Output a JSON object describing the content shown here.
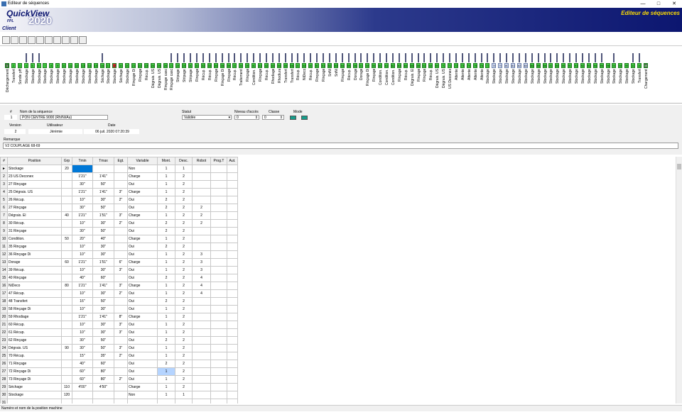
{
  "window": {
    "title": "Editeur de séquences",
    "min": "—",
    "max": "□",
    "close": "✕"
  },
  "banner": {
    "product": "QuickView",
    "fpl": "FPL",
    "year": "2020",
    "client": "Client",
    "heading": "Editeur de séquences"
  },
  "toolbar": {
    "tools": [
      "open-icon",
      "new-icon",
      "save-icon",
      "print-icon",
      "import-icon",
      "export-icon",
      "folder-icon",
      "tree-icon",
      "info-icon",
      "help-icon"
    ]
  },
  "sequence": {
    "positions": [
      "Déchargement",
      "Transfert",
      "Sonde pH",
      "Stockage",
      "Stockage",
      "Stockage",
      "Stockage",
      "Stockage",
      "Stockage",
      "Stockage",
      "Stockage",
      "Stockage",
      "Stockage",
      "Stockage",
      "Stockage",
      "Séchage",
      "Stockage",
      "Stockage",
      "Séchage",
      "Stockage",
      "Rinçage Di",
      "Rinçage",
      "Récup.",
      "Dégrais. US",
      "Dégrais. US",
      "Rinçage casc",
      "Rinçage casc",
      "Stripage",
      "Stripage",
      "Stripage",
      "Rinçage",
      "Récup.",
      "Récup.",
      "Rinçage",
      "Rinçage Di",
      "Rinçage",
      "Récup.",
      "Traitement",
      "Rinçage",
      "Condition.",
      "Rinçage",
      "Récup.",
      "Rhodiage",
      "Rhodiura",
      "Transfert",
      "Transfert",
      "Récup.",
      "NiDeco",
      "Récup.",
      "Rinçage",
      "Rinçage",
      "SnNi",
      "SnNi",
      "Rinçage",
      "Récup.",
      "Dorage",
      "Dorage",
      "Rinçage Di",
      "Rinçage",
      "Condition.",
      "Condition.",
      "Condition.",
      "Rinçage",
      "Récup.",
      "Dégrais. El",
      "Rinçage",
      "Rinçage",
      "Récup.",
      "Dégrais. US",
      "Dégrais. US",
      "US Deconex",
      "Attente",
      "Attente",
      "Attente",
      "Attente",
      "Attente",
      "Stockage",
      "Stockage",
      "Stockage",
      "Stockage",
      "Stockage",
      "Stockage",
      "Stockage",
      "Stockage",
      "Stockage",
      "Stockage",
      "Stockage",
      "Stockage",
      "Stockage",
      "Stockage",
      "Stockage",
      "Stockage",
      "Stockage",
      "Stockage",
      "Stockage",
      "Stockage",
      "Stockage",
      "Stockage",
      "Stockage",
      "Stockage",
      "Transfert",
      "Chargement"
    ]
  },
  "form": {
    "num_label": "#",
    "num_value": "1",
    "name_label": "Nom de la séquence",
    "name_value": "PON CENTRE 9000 (Rh/Ni/Au)",
    "statut_label": "Statut",
    "statut_value": "Validée",
    "niveau_label": "Niveau d'accès",
    "niveau_value": "0",
    "classe_label": "Classe",
    "classe_value": "0",
    "mode_label": "Mode",
    "version_label": "Version",
    "version_value": "2",
    "user_label": "Utilisateur",
    "user_value": "Jérémie",
    "date_label": "Date",
    "date_value": "06 juil. 2020 07:20:39",
    "remarque_label": "Remarque",
    "remarque_value": "V2 COUPLAGE 68-69"
  },
  "grid": {
    "headers": [
      "#",
      "Position",
      "Grp",
      "Tmin",
      "Tmax",
      "Egt.",
      "Variable",
      "Mont.",
      "Desc.",
      "Robot",
      "Prog.T",
      "Aut."
    ],
    "rows": [
      [
        "►",
        "Stockage",
        "20",
        "",
        "",
        "",
        "Non",
        "1",
        "1",
        "",
        "",
        ""
      ],
      [
        "2",
        "23 US Deconex",
        "",
        "1'21''",
        "1'41''",
        "",
        "Charge",
        "1",
        "2",
        "",
        "",
        ""
      ],
      [
        "3",
        "27 Rinçage",
        "",
        "30''",
        "50''",
        "",
        "Oui",
        "1",
        "2",
        "",
        "",
        ""
      ],
      [
        "4",
        "25 Dégrais. US",
        "",
        "1'21''",
        "1'41''",
        "3''",
        "Charge",
        "1",
        "2",
        "",
        "",
        ""
      ],
      [
        "5",
        "26 Récup.",
        "",
        "10''",
        "30''",
        "2''",
        "Oui",
        "2",
        "2",
        "",
        "",
        ""
      ],
      [
        "6",
        "27 Rinçage",
        "",
        "30''",
        "50''",
        "",
        "Oui",
        "2",
        "2",
        "2",
        "",
        ""
      ],
      [
        "7",
        "Dégrais. El",
        "40",
        "1'21''",
        "1'51''",
        "3''",
        "Charge",
        "1",
        "2",
        "2",
        "",
        ""
      ],
      [
        "8",
        "30 Récup.",
        "",
        "10''",
        "30''",
        "2''",
        "Oui",
        "2",
        "2",
        "2",
        "",
        ""
      ],
      [
        "9",
        "31 Rinçage",
        "",
        "30''",
        "50''",
        "",
        "Oui",
        "2",
        "2",
        "",
        "",
        ""
      ],
      [
        "10",
        "Condition.",
        "50",
        "20''",
        "40''",
        "",
        "Charge",
        "1",
        "2",
        "",
        "",
        ""
      ],
      [
        "11",
        "35 Rinçage",
        "",
        "10''",
        "30''",
        "",
        "Oui",
        "2",
        "2",
        "",
        "",
        ""
      ],
      [
        "12",
        "36 Rinçage Di",
        "",
        "10''",
        "30''",
        "",
        "Oui",
        "1",
        "2",
        "3",
        "",
        ""
      ],
      [
        "13",
        "Dorage",
        "60",
        "1'21''",
        "1'51''",
        "6''",
        "Charge",
        "1",
        "2",
        "3",
        "",
        ""
      ],
      [
        "14",
        "39 Récup.",
        "",
        "10''",
        "30''",
        "3''",
        "Oui",
        "1",
        "2",
        "3",
        "",
        ""
      ],
      [
        "15",
        "40 Rinçage",
        "",
        "40''",
        "60''",
        "",
        "Oui",
        "2",
        "2",
        "4",
        "",
        ""
      ],
      [
        "16",
        "NiDeco",
        "80",
        "1'21''",
        "1'41''",
        "3''",
        "Charge",
        "1",
        "2",
        "4",
        "",
        ""
      ],
      [
        "17",
        "47 Récup.",
        "",
        "10''",
        "30''",
        "2''",
        "Oui",
        "1",
        "2",
        "4",
        "",
        ""
      ],
      [
        "18",
        "48 Transfert",
        "",
        "16''",
        "50''",
        "",
        "Oui",
        "2",
        "2",
        "",
        "",
        ""
      ],
      [
        "19",
        "58 Rinçage Di",
        "",
        "10''",
        "30''",
        "",
        "Oui",
        "1",
        "2",
        "",
        "",
        ""
      ],
      [
        "20",
        "59 Rhodiage",
        "",
        "1'21''",
        "1'41''",
        "8''",
        "Charge",
        "1",
        "2",
        "",
        "",
        ""
      ],
      [
        "21",
        "60 Récup.",
        "",
        "10''",
        "30''",
        "3''",
        "Oui",
        "1",
        "2",
        "",
        "",
        ""
      ],
      [
        "22",
        "61 Récup.",
        "",
        "10''",
        "30''",
        "3''",
        "Oui",
        "1",
        "2",
        "",
        "",
        ""
      ],
      [
        "23",
        "62 Rinçage",
        "",
        "30''",
        "50''",
        "",
        "Oui",
        "2",
        "2",
        "",
        "",
        ""
      ],
      [
        "24",
        "Dégrais. US",
        "90",
        "30''",
        "50''",
        "3''",
        "Oui",
        "1",
        "2",
        "",
        "",
        ""
      ],
      [
        "25",
        "70 Récup.",
        "",
        "15''",
        "35''",
        "2''",
        "Oui",
        "1",
        "2",
        "",
        "",
        ""
      ],
      [
        "26",
        "71 Rinçage",
        "",
        "40''",
        "60''",
        "",
        "Oui",
        "2",
        "2",
        "",
        "",
        ""
      ],
      [
        "27",
        "72 Rinçage Di",
        "",
        "60''",
        "80''",
        "",
        "Oui",
        "1",
        "2",
        "",
        "",
        ""
      ],
      [
        "28",
        "73 Rinçage Di",
        "",
        "60''",
        "80''",
        "2''",
        "Oui",
        "1",
        "2",
        "",
        "",
        ""
      ],
      [
        "29",
        "Séchage",
        "110",
        "4'00''",
        "4'50''",
        "",
        "Charge",
        "1",
        "2",
        "",
        "",
        ""
      ],
      [
        "30",
        "Stockage",
        "120",
        "",
        "",
        "",
        "Non",
        "1",
        "1",
        "",
        "",
        ""
      ],
      [
        "31",
        "",
        "",
        "",
        "",
        "",
        "",
        "",
        "",
        "",
        "",
        ""
      ]
    ]
  },
  "status": {
    "text": "Numéro et nom de la position machine"
  }
}
